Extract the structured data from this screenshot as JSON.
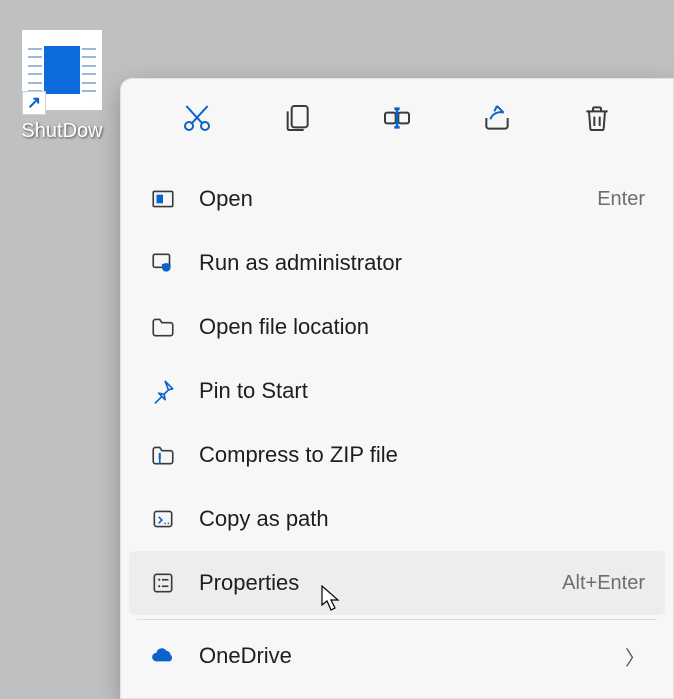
{
  "desktop": {
    "shortcut_label": "ShutDow"
  },
  "toolbar": {
    "cut": "Cut",
    "copy": "Copy",
    "rename": "Rename",
    "share": "Share",
    "delete": "Delete"
  },
  "menu": {
    "open": {
      "label": "Open",
      "shortcut": "Enter"
    },
    "run_admin": {
      "label": "Run as administrator"
    },
    "open_location": {
      "label": "Open file location"
    },
    "pin_start": {
      "label": "Pin to Start"
    },
    "compress": {
      "label": "Compress to ZIP file"
    },
    "copy_path": {
      "label": "Copy as path"
    },
    "properties": {
      "label": "Properties",
      "shortcut": "Alt+Enter"
    },
    "onedrive": {
      "label": "OneDrive"
    }
  }
}
